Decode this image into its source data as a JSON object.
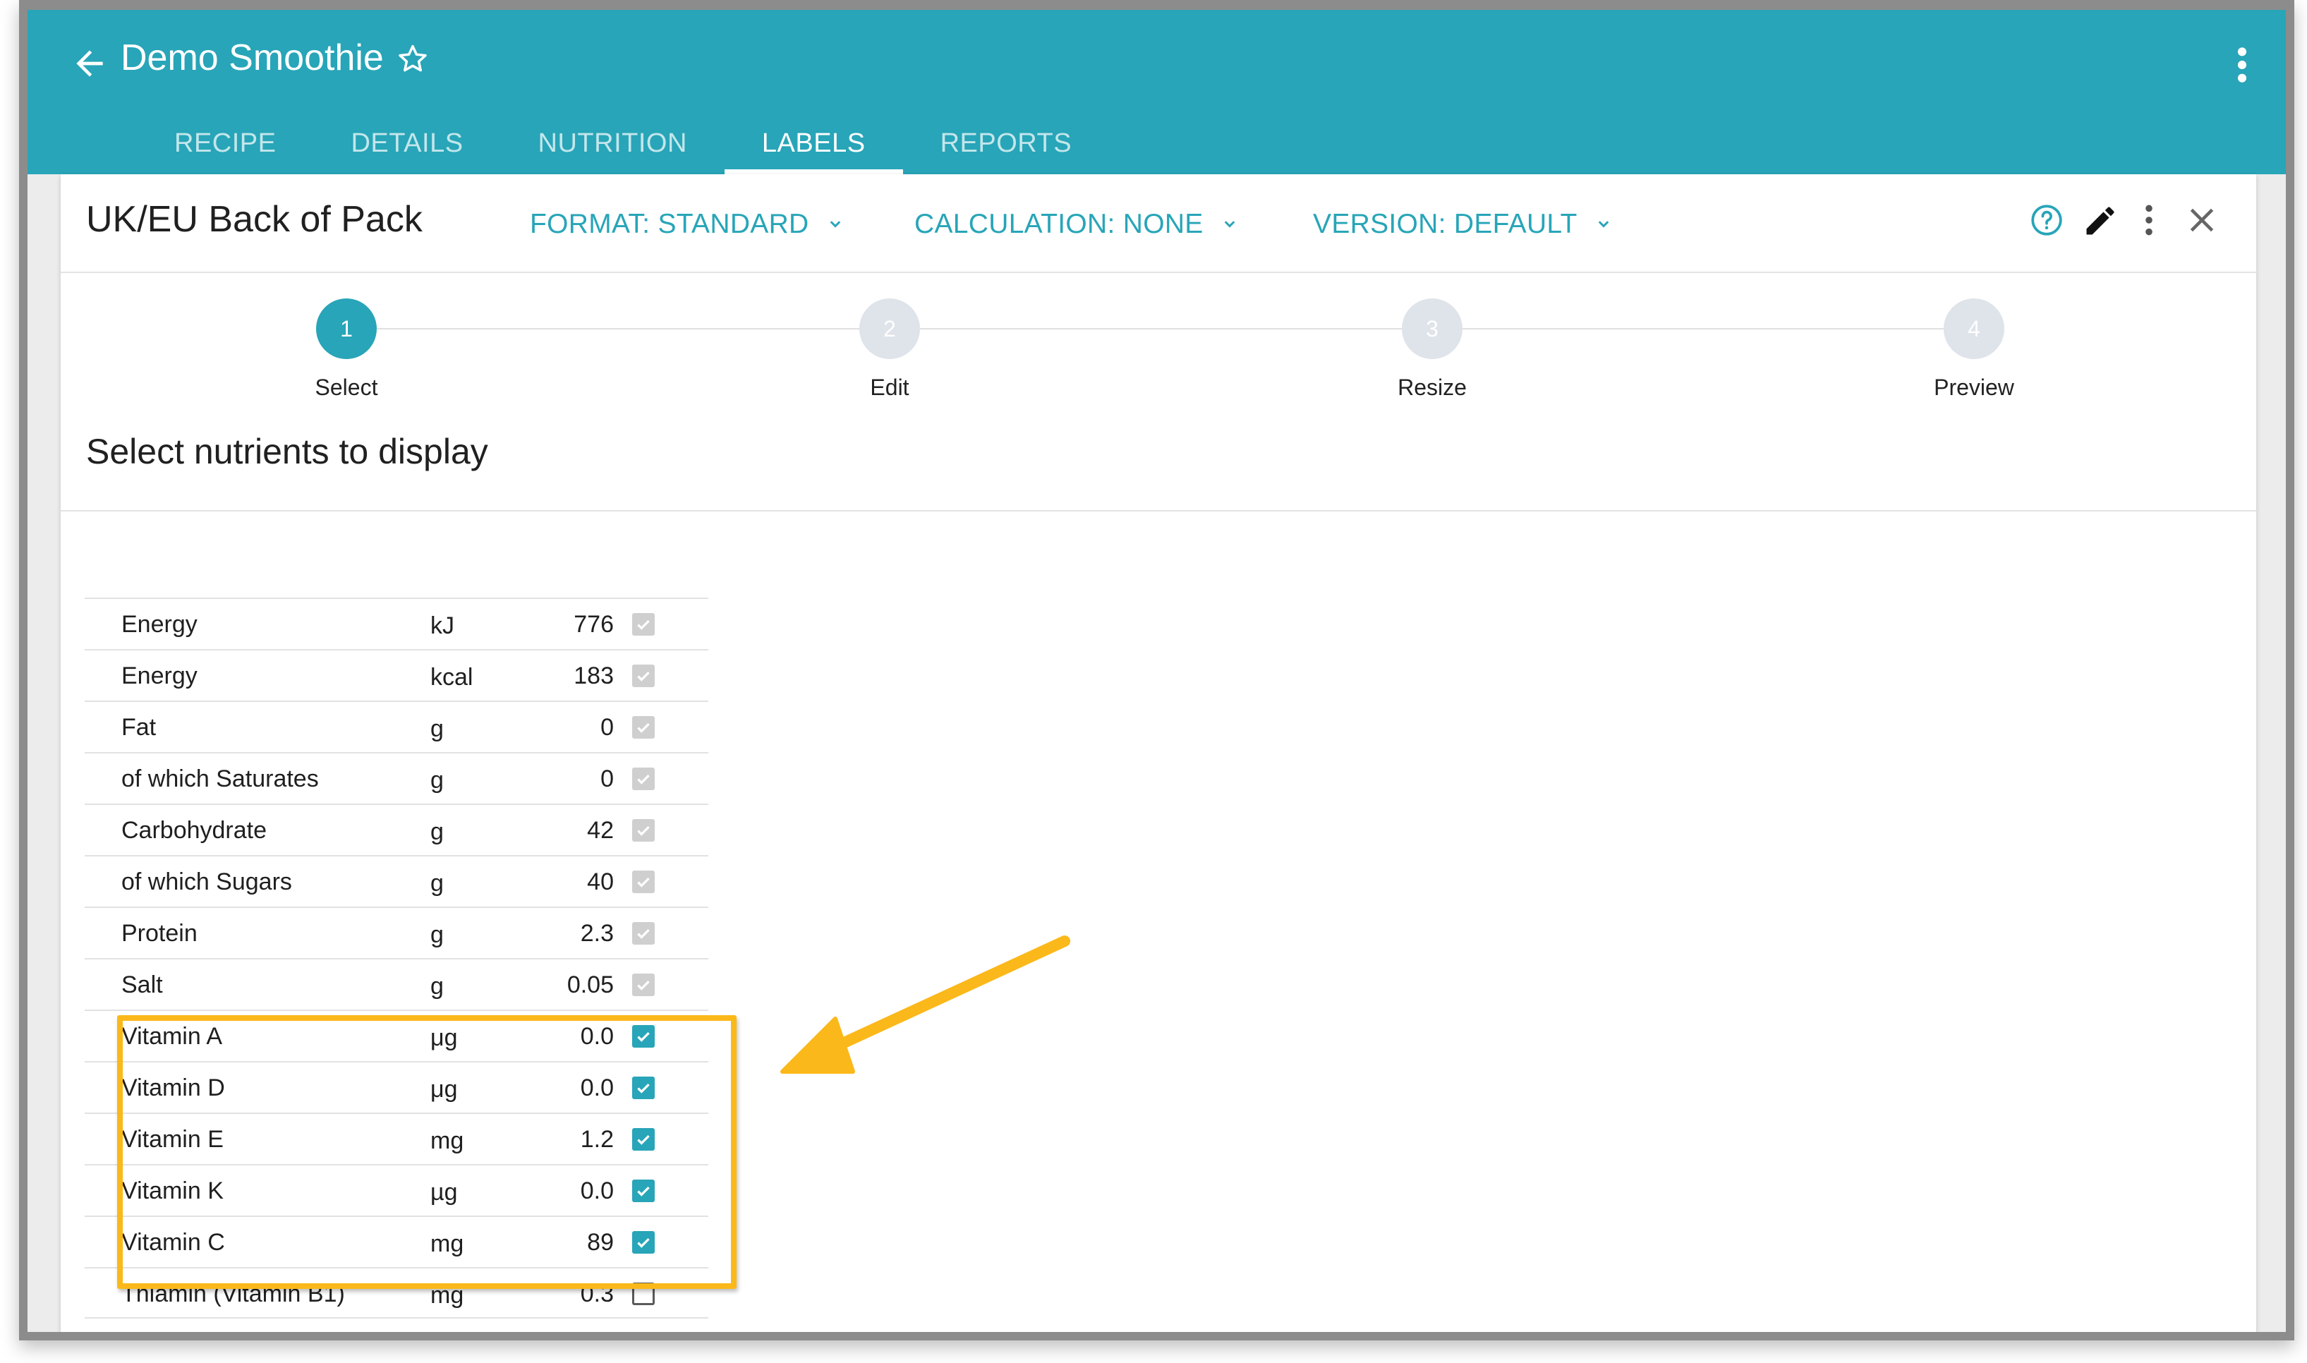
{
  "app": {
    "title": "Demo Smoothie",
    "tabs": [
      {
        "label": "RECIPE",
        "active": false
      },
      {
        "label": "DETAILS",
        "active": false
      },
      {
        "label": "NUTRITION",
        "active": false
      },
      {
        "label": "LABELS",
        "active": true
      },
      {
        "label": "REPORTS",
        "active": false
      }
    ]
  },
  "panel": {
    "title": "UK/EU Back of Pack",
    "format_label": "FORMAT: STANDARD",
    "calculation_label": "CALCULATION: NONE",
    "version_label": "VERSION: DEFAULT"
  },
  "stepper": {
    "steps": [
      {
        "number": "1",
        "label": "Select",
        "active": true
      },
      {
        "number": "2",
        "label": "Edit",
        "active": false
      },
      {
        "number": "3",
        "label": "Resize",
        "active": false
      },
      {
        "number": "4",
        "label": "Preview",
        "active": false
      }
    ]
  },
  "section_title": "Select nutrients to display",
  "nutrients": [
    {
      "name": "Energy",
      "unit": "kJ",
      "value": "776",
      "state": "disabled"
    },
    {
      "name": "Energy",
      "unit": "kcal",
      "value": "183",
      "state": "disabled"
    },
    {
      "name": "Fat",
      "unit": "g",
      "value": "0",
      "state": "disabled"
    },
    {
      "name": "of which Saturates",
      "unit": "g",
      "value": "0",
      "state": "disabled"
    },
    {
      "name": "Carbohydrate",
      "unit": "g",
      "value": "42",
      "state": "disabled"
    },
    {
      "name": "of which Sugars",
      "unit": "g",
      "value": "40",
      "state": "disabled"
    },
    {
      "name": "Protein",
      "unit": "g",
      "value": "2.3",
      "state": "disabled"
    },
    {
      "name": "Salt",
      "unit": "g",
      "value": "0.05",
      "state": "disabled"
    },
    {
      "name": "Vitamin A",
      "unit": "μg",
      "value": "0.0",
      "state": "on"
    },
    {
      "name": "Vitamin D",
      "unit": "μg",
      "value": "0.0",
      "state": "on"
    },
    {
      "name": "Vitamin E",
      "unit": "mg",
      "value": "1.2",
      "state": "on"
    },
    {
      "name": "Vitamin K",
      "unit": "µg",
      "value": "0.0",
      "state": "on"
    },
    {
      "name": "Vitamin C",
      "unit": "mg",
      "value": "89",
      "state": "on"
    },
    {
      "name": "Thiamin (Vitamin B1)",
      "unit": "mg",
      "value": "0.3",
      "state": "off"
    }
  ],
  "colors": {
    "accent": "#28a5b8",
    "highlight": "#fbb81a"
  }
}
